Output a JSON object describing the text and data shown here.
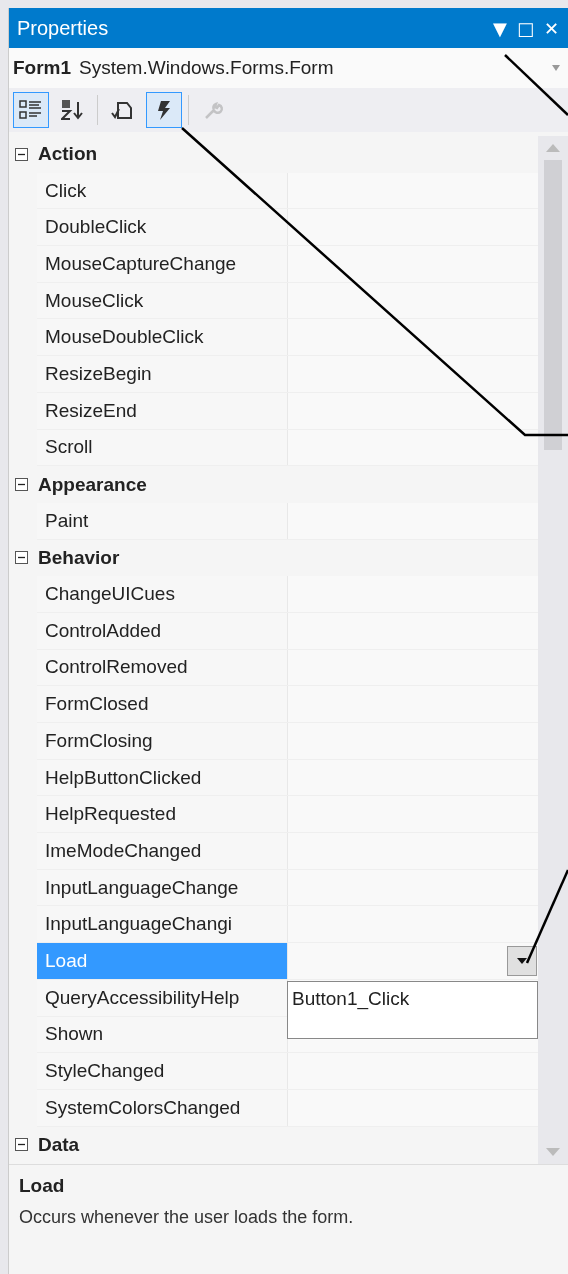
{
  "window": {
    "title": "Properties",
    "controls": [
      "▼",
      "□",
      "✕"
    ]
  },
  "object_selector": {
    "name": "Form1",
    "type": "System.Windows.Forms.Form"
  },
  "toolbar": [
    {
      "kind": "categorized",
      "selected": true,
      "disabled": false
    },
    {
      "kind": "alphabetical",
      "selected": false,
      "disabled": false
    },
    {
      "kind": "separator"
    },
    {
      "kind": "properties",
      "selected": false,
      "disabled": false
    },
    {
      "kind": "events",
      "selected": true,
      "disabled": false
    },
    {
      "kind": "separator"
    },
    {
      "kind": "property_pages",
      "selected": false,
      "disabled": true
    }
  ],
  "categories": [
    {
      "name": "Action",
      "expanded": true,
      "items": [
        {
          "name": "Click",
          "selected": false
        },
        {
          "name": "DoubleClick",
          "selected": false
        },
        {
          "name": "MouseCaptureChange",
          "selected": false
        },
        {
          "name": "MouseClick",
          "selected": false
        },
        {
          "name": "MouseDoubleClick",
          "selected": false
        },
        {
          "name": "ResizeBegin",
          "selected": false
        },
        {
          "name": "ResizeEnd",
          "selected": false
        },
        {
          "name": "Scroll",
          "selected": false
        }
      ]
    },
    {
      "name": "Appearance",
      "expanded": true,
      "items": [
        {
          "name": "Paint",
          "selected": false
        }
      ]
    },
    {
      "name": "Behavior",
      "expanded": true,
      "items": [
        {
          "name": "ChangeUICues",
          "selected": false
        },
        {
          "name": "ControlAdded",
          "selected": false
        },
        {
          "name": "ControlRemoved",
          "selected": false
        },
        {
          "name": "FormClosed",
          "selected": false
        },
        {
          "name": "FormClosing",
          "selected": false
        },
        {
          "name": "HelpButtonClicked",
          "selected": false
        },
        {
          "name": "HelpRequested",
          "selected": false
        },
        {
          "name": "ImeModeChanged",
          "selected": false
        },
        {
          "name": "InputLanguageChange",
          "selected": false
        },
        {
          "name": "InputLanguageChangi",
          "selected": false
        },
        {
          "name": "Load",
          "selected": true,
          "dropdown": [
            "Button1_Click"
          ]
        },
        {
          "name": "QueryAccessibilityHelp",
          "selected": false
        },
        {
          "name": "Shown",
          "selected": false
        },
        {
          "name": "StyleChanged",
          "selected": false
        },
        {
          "name": "SystemColorsChanged",
          "selected": false
        }
      ]
    },
    {
      "name": "Data",
      "expanded": true
    }
  ],
  "description": {
    "title": "Load",
    "text": "Occurs whenever the user loads the form."
  }
}
